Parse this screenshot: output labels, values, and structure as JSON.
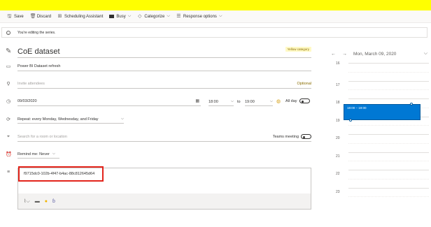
{
  "toolbar": {
    "save": "Save",
    "discard": "Discard",
    "scheduling": "Scheduling Assistant",
    "busy": "Busy",
    "categorize": "Categorize",
    "response": "Response options"
  },
  "info": {
    "text": "You're editing the series."
  },
  "form": {
    "title": "CoE dataset",
    "category": "Yellow category",
    "calendar": "Power BI Dataset refresh",
    "attendees_placeholder": "Invite attendees",
    "optional": "Optional",
    "date": "09/03/2020",
    "start_time": "18:00",
    "to": "to",
    "end_time": "19:00",
    "all_day": "All day",
    "repeat": "Repeat: every Monday, Wednesday, and Friday",
    "location_placeholder": "Search for a room or location",
    "teams": "Teams meeting",
    "remind": "Remind me: Never",
    "body_text": "f9715dc0-102b-4f47-b4ac-88c812645d64"
  },
  "calendar": {
    "date_label": "Mon, March 09, 2020",
    "hours": [
      "16",
      "17",
      "18",
      "19",
      "20",
      "21",
      "22",
      "23"
    ],
    "event_time": "18:00 – 19:00"
  },
  "colors": {
    "highlight": "#ffff00",
    "event": "#0078d4",
    "annotation": "#e3241b"
  }
}
